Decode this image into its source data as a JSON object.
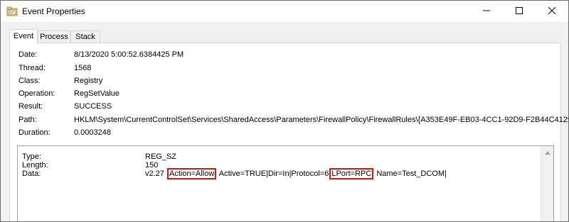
{
  "window": {
    "title": "Event Properties"
  },
  "tabs": [
    {
      "label": "Event"
    },
    {
      "label": "Process"
    },
    {
      "label": "Stack"
    }
  ],
  "properties": [
    {
      "label": "Date:",
      "value": "8/13/2020 5:00:52.6384425 PM"
    },
    {
      "label": "Thread:",
      "value": "1568"
    },
    {
      "label": "Class:",
      "value": "Registry"
    },
    {
      "label": "Operation:",
      "value": "RegSetValue"
    },
    {
      "label": "Result:",
      "value": "SUCCESS"
    },
    {
      "label": "Path:",
      "value": "HKLM\\System\\CurrentControlSet\\Services\\SharedAccess\\Parameters\\FirewallPolicy\\FirewallRules\\{A353E49F-EB03-4CC1-92D9-F2B44C4129"
    },
    {
      "label": "Duration:",
      "value": "0.0003248"
    }
  ],
  "details": {
    "type_label": "Type:",
    "type_value": "REG_SZ",
    "length_label": "Length:",
    "length_value": "150",
    "data_label": "Data:",
    "data_parts": {
      "p1": "v2.27",
      "h1": "Action=Allow",
      "p2": "Active=TRUE|Dir=In|Protocol=6",
      "h2": "LPort=RPC",
      "p3": "Name=Test_DCOM|"
    }
  },
  "colors": {
    "highlight_box": "#e01010",
    "window_bg": "#f0f0f0",
    "panel_bg": "#ffffff"
  },
  "icons": {
    "app": "event-properties-app-icon",
    "minimize": "minimize-icon",
    "maximize": "maximize-icon",
    "close": "close-icon",
    "scroll_up": "scroll-up-arrow-icon"
  }
}
